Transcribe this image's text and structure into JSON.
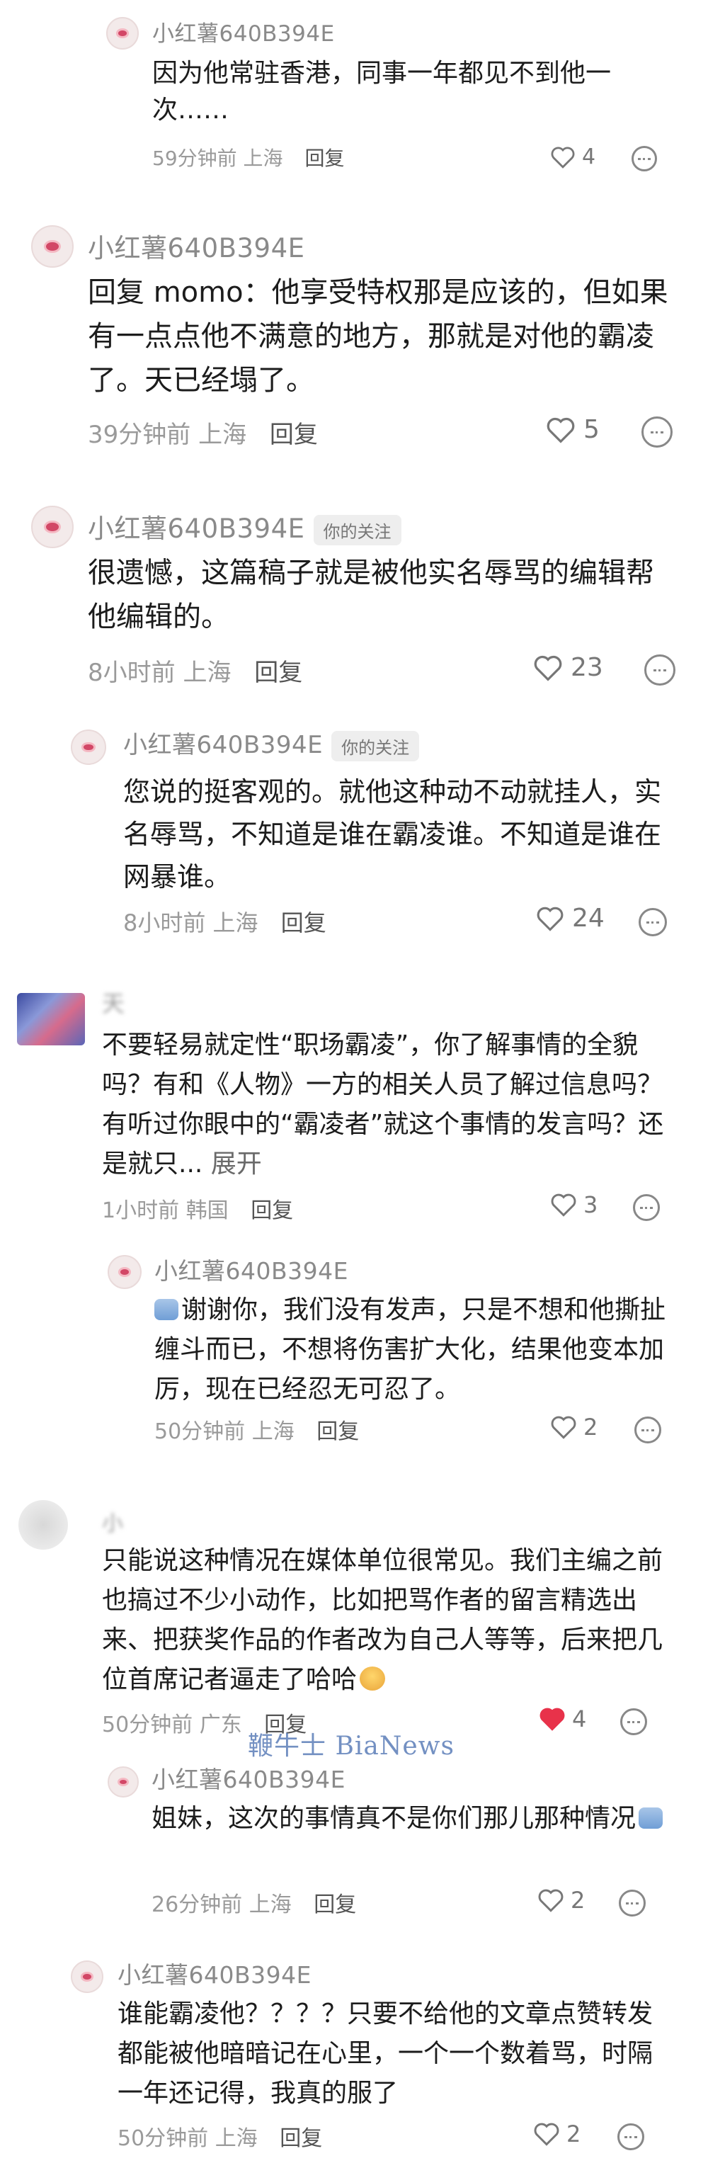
{
  "comments": [
    {
      "username": "小红薯640B394E",
      "text": "因为他常驻香港，同事一年都见不到他一次……",
      "time": "59分钟前",
      "location": "上海",
      "reply": "回复",
      "likes": "4"
    },
    {
      "username": "小红薯640B394E",
      "text": "回复 momo：他享受特权那是应该的，但如果有一点点他不满意的地方，那就是对他的霸凌了。天已经塌了。",
      "time": "39分钟前",
      "location": "上海",
      "reply": "回复",
      "likes": "5"
    },
    {
      "username": "小红薯640B394E",
      "tag": "你的关注",
      "text": "很遗憾，这篇稿子就是被他实名辱骂的编辑帮他编辑的。",
      "time": "8小时前",
      "location": "上海",
      "reply": "回复",
      "likes": "23"
    },
    {
      "username": "小红薯640B394E",
      "tag": "你的关注",
      "text": "您说的挺客观的。就他这种动不动就挂人，实名辱骂，不知道是谁在霸凌谁。不知道是谁在网暴谁。",
      "time": "8小时前",
      "location": "上海",
      "reply": "回复",
      "likes": "24"
    },
    {
      "username": "天",
      "text": "不要轻易就定性“职场霸凌”，你了解事情的全貌吗？有和《人物》一方的相关人员了解过信息吗？有听过你眼中的“霸凌者”就这个事情的发言吗？还是就只...",
      "expand": "展开",
      "time": "1小时前",
      "location": "韩国",
      "reply": "回复",
      "likes": "3"
    },
    {
      "username": "小红薯640B394E",
      "text": "谢谢你，我们没有发声，只是不想和他撕扯缠斗而已，不想将伤害扩大化，结果他变本加厉，现在已经忍无可忍了。",
      "time": "50分钟前",
      "location": "上海",
      "reply": "回复",
      "likes": "2"
    },
    {
      "username": "小",
      "text": "只能说这种情况在媒体单位很常见。我们主编之前也搞过不少小动作，比如把骂作者的留言精选出来、把获奖作品的作者改为自己人等等，后来把几位首席记者逼走了哈哈",
      "time": "50分钟前",
      "location": "广东",
      "reply": "回复",
      "likes": "4"
    },
    {
      "username": "小红薯640B394E",
      "text": "姐妹，这次的事情真不是你们那儿那种情况",
      "time": "26分钟前",
      "location": "上海",
      "reply": "回复",
      "likes": "2"
    },
    {
      "username": "小红薯640B394E",
      "text": "谁能霸凌他？？？？只要不给他的文章点赞转发都能被他暗暗记在心里，一个一个数着骂，时隔一年还记得，我真的服了",
      "time": "50分钟前",
      "location": "上海",
      "reply": "回复",
      "likes": "2"
    }
  ],
  "watermark": "鞭牛士 BiaNews",
  "colors": {
    "liked_heart": "#e8324a",
    "text": "#1c1c1c",
    "meta": "#9a9a9a",
    "watermark": "#5b7db8"
  },
  "icons": {
    "avatar": "user-avatar",
    "like": "heart-icon",
    "more": "more-dots-icon"
  }
}
